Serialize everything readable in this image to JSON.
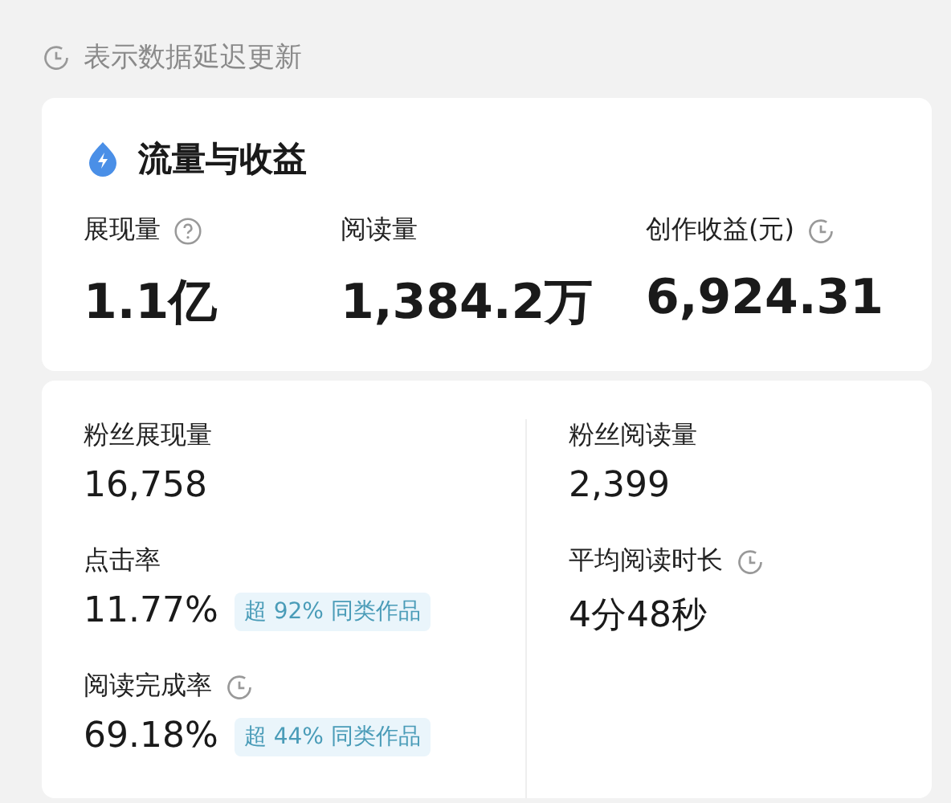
{
  "notice": {
    "text": "表示数据延迟更新"
  },
  "summary": {
    "title": "流量与收益",
    "metrics": [
      {
        "kind": "help",
        "label": "展现量",
        "value": "1.1亿"
      },
      {
        "kind": "plain",
        "label": "阅读量",
        "value": "1,384.2万"
      },
      {
        "kind": "clock",
        "label": "创作收益(元)",
        "value": "6,924.31"
      }
    ]
  },
  "details": {
    "columns": [
      [
        {
          "kind": "plain",
          "label": "粉丝展现量",
          "value": "16,758"
        },
        {
          "kind": "plain",
          "label": "点击率",
          "value": "11.77%",
          "badge": "超 92% 同类作品"
        },
        {
          "kind": "clock",
          "label": "阅读完成率",
          "value": "69.18%",
          "badge": "超 44% 同类作品"
        }
      ],
      [
        {
          "kind": "plain",
          "label": "粉丝阅读量",
          "value": "2,399"
        },
        {
          "kind": "clock",
          "label": "平均阅读时长",
          "value": "4分48秒"
        }
      ]
    ]
  }
}
